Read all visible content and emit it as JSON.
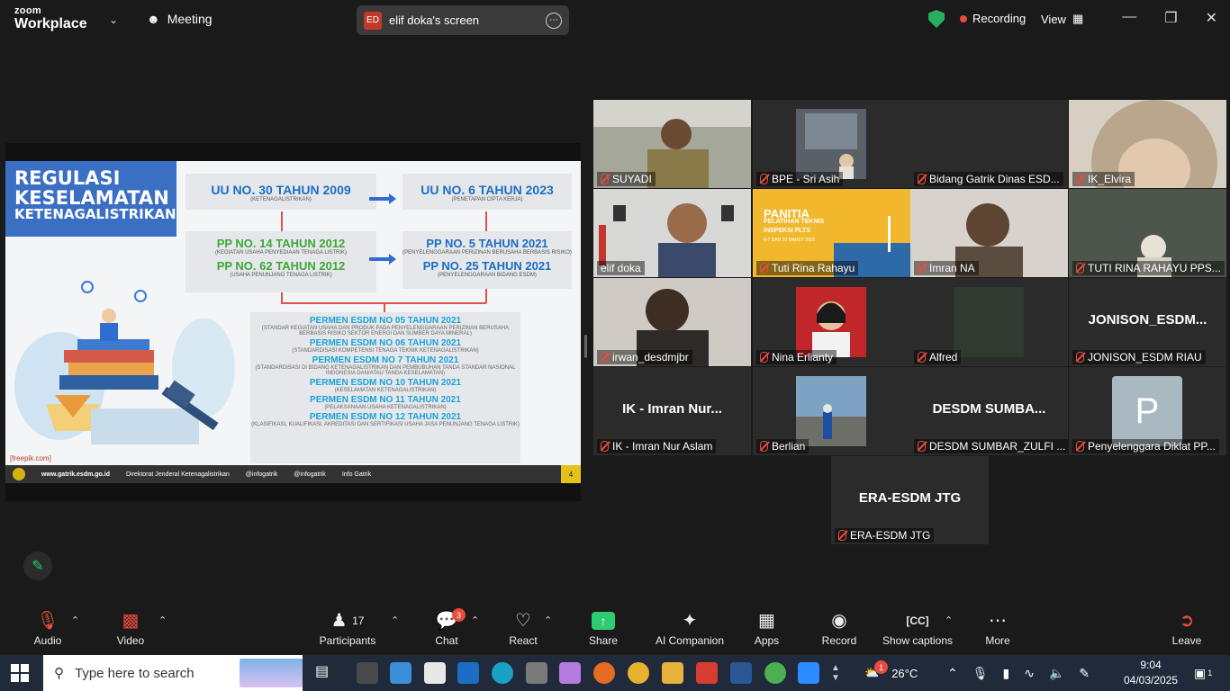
{
  "topbar": {
    "logo_line1": "zoom",
    "logo_line2": "Workplace",
    "meeting_label": "Meeting",
    "screen_badge": "ED",
    "screen_title": "elif doka's screen",
    "recording_label": "Recording",
    "view_label": "View"
  },
  "slide": {
    "title": [
      "REGULASI",
      "KESELAMATAN",
      "KETENAGALISTRIKAN"
    ],
    "uu30": "UU NO. 30 TAHUN 2009",
    "uu30_sub": "(KETENAGALISTRIKAN)",
    "uu6": "UU NO. 6 TAHUN 2023",
    "uu6_sub": "(PENETAPAN CIPTA KERJA)",
    "pp14": "PP NO. 14 TAHUN 2012",
    "pp14_sub": "(KEGIATAN USAHA PENYEDIAAN TENAGA LISTRIK)",
    "pp62": "PP NO. 62 TAHUN 2012",
    "pp62_sub": "(USAHA PENUNJANG TENAGA LISTRIK)",
    "pp5": "PP NO. 5 TAHUN 2021",
    "pp5_sub": "(PENYELENGGARAAN PERIZINAN BERUSAHA BERBASIS RISIKO)",
    "pp25": "PP NO. 25 TAHUN 2021",
    "pp25_sub": "(PENYELENGGARAAN BIDANG ESDM)",
    "permen": [
      {
        "title": "PERMEN ESDM NO 05 TAHUN 2021",
        "sub": "(STANDAR KEGIATAN USAHA DAN PRODUK PADA PENYELENGGARAAN PERIZINAN BERUSAHA BERBASIS RISIKO SEKTOR ENERGI DAN SUMBER DAYA MINERAL)"
      },
      {
        "title": "PERMEN ESDM NO 06 TAHUN 2021",
        "sub": "(STANDARDISASI KOMPETENSI TENAGA TEKNIK KETENAGALISTRIKAN)"
      },
      {
        "title": "PERMEN ESDM NO 7 TAHUN 2021",
        "sub": "(STANDARDISASI DI BIDANG KETENAGALISTRIKAN DAN PEMBUBUHAN TANDA STANDAR NASIONAL INDONESIA DAN/ATAU TANDA KESELAMATAN)"
      },
      {
        "title": "PERMEN ESDM NO 10 TAHUN 2021",
        "sub": "(KESELAMATAN KETENAGALISTRIKAN)"
      },
      {
        "title": "PERMEN ESDM NO 11 TAHUN 2021",
        "sub": "(PELAKSANAAN USAHA KETENAGALISTRIKAN)"
      },
      {
        "title": "PERMEN ESDM NO 12 TAHUN 2021",
        "sub": "(KLASIFIKASI, KUALIFIKASI, AKREDITASI DAN SERTIFIKASI USAHA JASA PENUNJANG TENAGA LISTRIK)"
      }
    ],
    "credit": "[freepik.com]",
    "footer_site": "www.gatrik.esdm.go.id",
    "footer_fb": "Direktorat Jenderal Ketenagalistrikan",
    "footer_tw": "@infogatrik",
    "footer_ig": "@infogatrik",
    "footer_yt": "Info Gatrik",
    "page": "4"
  },
  "participants": [
    {
      "name": "SUYADI",
      "big": "",
      "color": "#8a8a7a"
    },
    {
      "name": "BPE - Sri Asih",
      "big": "",
      "color": "#2b2b2b"
    },
    {
      "name": "Bidang Gatrik Dinas ESD...",
      "big": "",
      "color": "#2b2b2b"
    },
    {
      "name": "IK_Elvira",
      "big": "",
      "color": "#c7b9a5"
    },
    {
      "name": "elif doka",
      "big": "",
      "color": "#c9c9c9"
    },
    {
      "name": "Tuti Rina Rahayu",
      "big": "",
      "color": "#f1b82d"
    },
    {
      "name": "Imran NA",
      "big": "",
      "color": "#9c8f83"
    },
    {
      "name": "TUTI RINA RAHAYU PPS...",
      "big": "",
      "color": "#6a6f68"
    },
    {
      "name": "irwan_desdmjbr",
      "big": "",
      "color": "#b8b4ae"
    },
    {
      "name": "Nina Erlianty",
      "big": "",
      "color": "#2b2b2b"
    },
    {
      "name": "Alfred",
      "big": "",
      "color": "#2b2b2b"
    },
    {
      "name": "JONISON_ESDM RIAU",
      "big": "JONISON_ESDM...",
      "color": "#2b2b2b"
    },
    {
      "name": "IK - Imran Nur Aslam",
      "big": "IK - Imran Nur...",
      "color": "#2b2b2b"
    },
    {
      "name": "Berlian",
      "big": "",
      "color": "#2b2b2b"
    },
    {
      "name": "DESDM SUMBAR_ZULFI ...",
      "big": "DESDM  SUMBA...",
      "color": "#2b2b2b"
    },
    {
      "name": "Penyelenggara Diklat PP...",
      "big": "",
      "color": "#2b2b2b"
    },
    {
      "name": "ERA-ESDM JTG",
      "big": "ERA-ESDM JTG",
      "color": "#2b2b2b"
    }
  ],
  "tuti_slide": {
    "title": "PANITIA",
    "sub1": "PELATIHAN TEKNIS",
    "sub2": "INSPEKSI PLTS",
    "date": "4-7 DAN 10 MARET 2025"
  },
  "avatar_letter": "P",
  "toolbar": {
    "audio": "Audio",
    "video": "Video",
    "participants": "Participants",
    "participants_count": "17",
    "chat": "Chat",
    "chat_badge": "3",
    "react": "React",
    "share": "Share",
    "ai": "AI Companion",
    "apps": "Apps",
    "record": "Record",
    "captions": "Show captions",
    "more": "More",
    "leave": "Leave"
  },
  "taskbar": {
    "search_placeholder": "Type here to search",
    "weather_badge": "1",
    "temperature": "26°C",
    "time": "9:04",
    "date": "04/03/2025",
    "notif_count": "1"
  },
  "colors": {
    "accent_green": "#2ecc71",
    "record_red": "#e74c3c",
    "slide_blue": "#1a6fc4",
    "slide_green": "#3aa936"
  }
}
